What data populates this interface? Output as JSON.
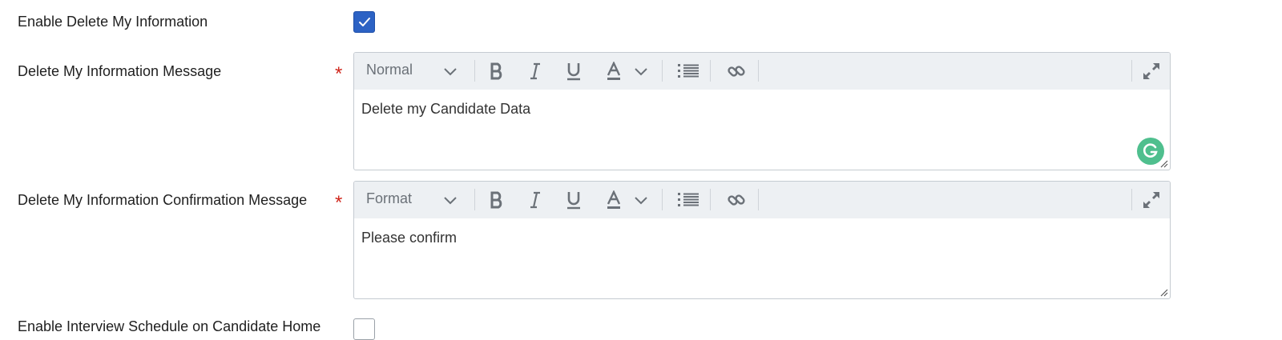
{
  "settings": {
    "enable_delete": {
      "label": "Enable Delete My Information",
      "checked": true
    },
    "delete_message": {
      "label": "Delete My Information Message",
      "required_mark": "*",
      "format_value": "Normal",
      "content": "Delete my Candidate Data"
    },
    "confirmation_message": {
      "label": "Delete My Information Confirmation Message",
      "required_mark": "*",
      "format_value": "Format",
      "content": "Please confirm"
    },
    "enable_interview": {
      "label": "Enable Interview Schedule on Candidate Home",
      "checked": false
    }
  },
  "toolbar_icons": [
    "format-dropdown",
    "bold-icon",
    "italic-icon",
    "underline-icon",
    "text-color-icon",
    "chevron-down-icon",
    "bulleted-list-icon",
    "link-icon",
    "maximize-icon"
  ],
  "colors": {
    "accent": "#2c62c4",
    "required": "#d0271d",
    "toolbar_bg": "#edf0f3",
    "grammarly": "#4fbf8e"
  }
}
